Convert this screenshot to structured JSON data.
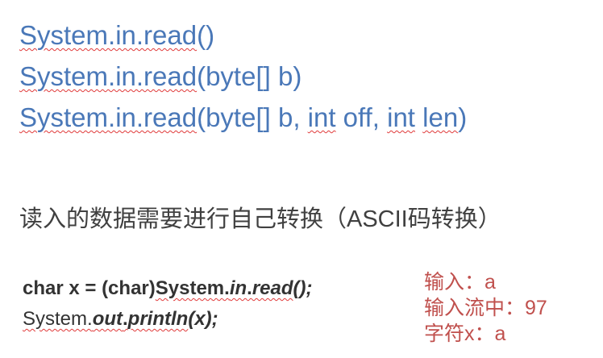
{
  "signatures": [
    {
      "prefix": "System.in.read",
      "params_squiggled": [],
      "text": "()"
    },
    {
      "prefix": "System.in.read",
      "text": "(byte[] b)"
    },
    {
      "prefix": "System.in.read",
      "open": "(byte[] b, ",
      "int1": "int",
      "mid": " off, ",
      "int2": "int",
      "sp": " ",
      "len": "len",
      "close": ")"
    }
  ],
  "description": "读入的数据需要进行自己转换（ASCII码转换）",
  "code": {
    "line1": {
      "start": "char x = (char)",
      "system": "System.",
      "in": "in",
      "dot": ".",
      "read": "read",
      "end": "();"
    },
    "line2": {
      "system": "System.",
      "out": "out",
      "dot": ".",
      "println": "println",
      "end": "(x);"
    }
  },
  "notes": [
    "输入：a",
    "输入流中：97",
    "字符x：a"
  ],
  "colors": {
    "blue": "#4a78b8",
    "red": "#c0504d",
    "text": "#404040"
  }
}
